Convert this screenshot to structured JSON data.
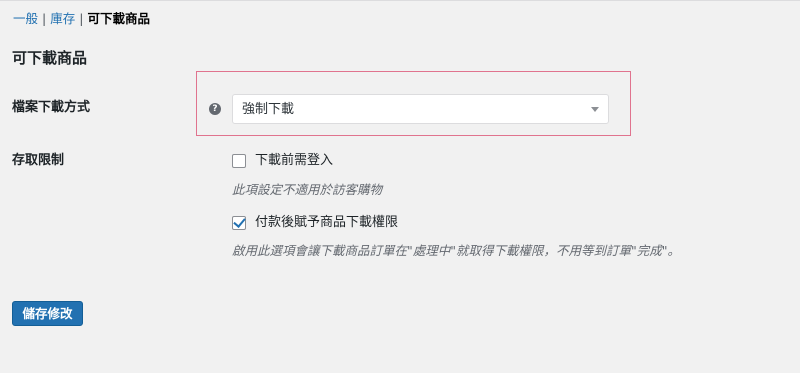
{
  "breadcrumb": {
    "items": [
      {
        "label": "一般"
      },
      {
        "label": "庫存"
      },
      {
        "label": "可下載商品"
      }
    ],
    "separator": "|"
  },
  "section": {
    "title": "可下載商品"
  },
  "download_method": {
    "label": "檔案下載方式",
    "help_icon": "?",
    "selected": "強制下載",
    "highlight_color": "#e0738e"
  },
  "access_restriction": {
    "label": "存取限制",
    "options": [
      {
        "label": "下載前需登入",
        "checked": false,
        "description": "此項設定不適用於訪客購物"
      },
      {
        "label": "付款後賦予商品下載權限",
        "checked": true,
        "description": "啟用此選項會讓下載商品訂單在\"處理中\"就取得下載權限，不用等到訂單\"完成\"。"
      }
    ]
  },
  "save_button": {
    "label": "儲存修改",
    "color": "#2271b1"
  }
}
